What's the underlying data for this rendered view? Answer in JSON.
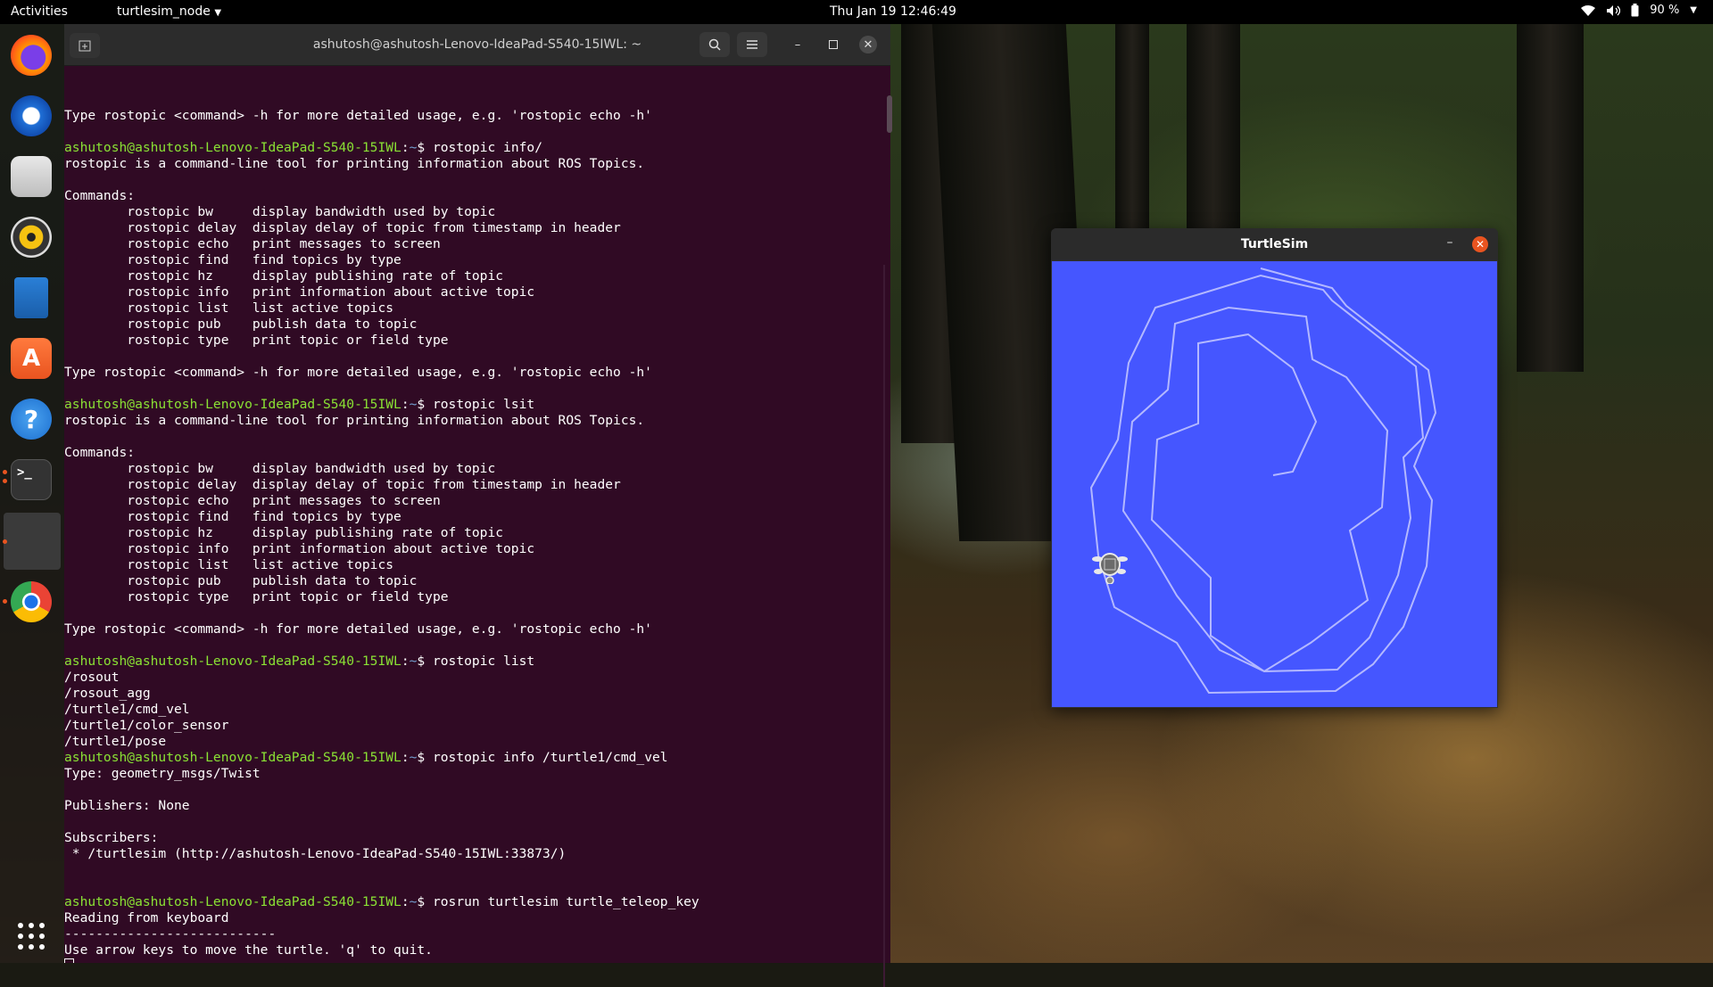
{
  "topbar": {
    "activities": "Activities",
    "app_menu": "turtlesim_node",
    "clock": "Thu Jan 19  12:46:49",
    "battery": "90 %"
  },
  "dock": {
    "apps": [
      {
        "name": "firefox-icon"
      },
      {
        "name": "thunderbird-icon"
      },
      {
        "name": "files-icon"
      },
      {
        "name": "rhythmbox-icon"
      },
      {
        "name": "writer-icon"
      },
      {
        "name": "app-center-icon"
      },
      {
        "name": "help-icon"
      },
      {
        "name": "terminal-icon"
      },
      {
        "name": "window-preview-icon"
      },
      {
        "name": "chrome-icon"
      },
      {
        "name": "show-apps-icon"
      }
    ]
  },
  "terminal": {
    "title": "ashutosh@ashutosh-Lenovo-IdeaPad-S540-15IWL: ~",
    "prompt_user": "ashutosh@ashutosh-Lenovo-IdeaPad-S540-15IWL",
    "prompt_path": "~",
    "lines": [
      {
        "t": "Type rostopic <command> -h for more detailed usage, e.g. 'rostopic echo -h'"
      },
      {
        "t": ""
      },
      {
        "cmd": "rostopic info/"
      },
      {
        "t": "rostopic is a command-line tool for printing information about ROS Topics."
      },
      {
        "t": ""
      },
      {
        "t": "Commands:"
      },
      {
        "t": "        rostopic bw     display bandwidth used by topic"
      },
      {
        "t": "        rostopic delay  display delay of topic from timestamp in header"
      },
      {
        "t": "        rostopic echo   print messages to screen"
      },
      {
        "t": "        rostopic find   find topics by type"
      },
      {
        "t": "        rostopic hz     display publishing rate of topic"
      },
      {
        "t": "        rostopic info   print information about active topic"
      },
      {
        "t": "        rostopic list   list active topics"
      },
      {
        "t": "        rostopic pub    publish data to topic"
      },
      {
        "t": "        rostopic type   print topic or field type"
      },
      {
        "t": ""
      },
      {
        "t": "Type rostopic <command> -h for more detailed usage, e.g. 'rostopic echo -h'"
      },
      {
        "t": ""
      },
      {
        "cmd": "rostopic lsit"
      },
      {
        "t": "rostopic is a command-line tool for printing information about ROS Topics."
      },
      {
        "t": ""
      },
      {
        "t": "Commands:"
      },
      {
        "t": "        rostopic bw     display bandwidth used by topic"
      },
      {
        "t": "        rostopic delay  display delay of topic from timestamp in header"
      },
      {
        "t": "        rostopic echo   print messages to screen"
      },
      {
        "t": "        rostopic find   find topics by type"
      },
      {
        "t": "        rostopic hz     display publishing rate of topic"
      },
      {
        "t": "        rostopic info   print information about active topic"
      },
      {
        "t": "        rostopic list   list active topics"
      },
      {
        "t": "        rostopic pub    publish data to topic"
      },
      {
        "t": "        rostopic type   print topic or field type"
      },
      {
        "t": ""
      },
      {
        "t": "Type rostopic <command> -h for more detailed usage, e.g. 'rostopic echo -h'"
      },
      {
        "t": ""
      },
      {
        "cmd": "rostopic list"
      },
      {
        "t": "/rosout"
      },
      {
        "t": "/rosout_agg"
      },
      {
        "t": "/turtle1/cmd_vel"
      },
      {
        "t": "/turtle1/color_sensor"
      },
      {
        "t": "/turtle1/pose"
      },
      {
        "cmd": "rostopic info /turtle1/cmd_vel"
      },
      {
        "t": "Type: geometry_msgs/Twist"
      },
      {
        "t": ""
      },
      {
        "t": "Publishers: None"
      },
      {
        "t": ""
      },
      {
        "t": "Subscribers: "
      },
      {
        "t": " * /turtlesim (http://ashutosh-Lenovo-IdeaPad-S540-15IWL:33873/)"
      },
      {
        "t": ""
      },
      {
        "t": ""
      },
      {
        "cmd": "rosrun turtlesim turtle_teleop_key"
      },
      {
        "t": "Reading from keyboard"
      },
      {
        "t": "---------------------------"
      },
      {
        "t": "Use arrow keys to move the turtle. 'q' to quit."
      },
      {
        "cursor": true
      }
    ]
  },
  "turtlesim": {
    "title": "TurtleSim",
    "background": "#4556ff",
    "pen_color": "#b3b8ff"
  }
}
